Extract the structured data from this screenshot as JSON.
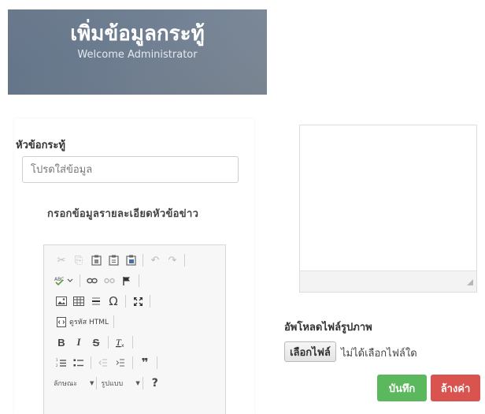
{
  "header": {
    "title": "เพิ่มข้อมูลกระทู้",
    "subtitle": "Welcome Administrator"
  },
  "form": {
    "subject_label": "หัวข้อกระทู้",
    "subject_placeholder": "โปรดใส่ข้อมูล",
    "detail_label": "กรอกข้อมูลรายละเอียดหัวข้อข่าว"
  },
  "editor": {
    "source_label": "ดูรหัส HTML",
    "format_combo": "ลักษณะ",
    "style_combo": "รูปแบบ",
    "help_label": "?",
    "icons": [
      "cut-icon",
      "copy-icon",
      "paste-icon",
      "paste-text-icon",
      "paste-word-icon",
      "undo-icon",
      "redo-icon",
      "spellcheck-icon",
      "link-icon",
      "unlink-icon",
      "anchor-icon",
      "image-icon",
      "table-icon",
      "horizontal-rule-icon",
      "special-char-icon",
      "maximize-icon",
      "source-icon",
      "bold-icon",
      "italic-icon",
      "strike-icon",
      "remove-format-icon",
      "numbered-list-icon",
      "bulleted-list-icon",
      "outdent-icon",
      "indent-icon",
      "blockquote-icon"
    ]
  },
  "upload": {
    "label": "อัพโหลดไฟล์รูปภาพ",
    "button": "เลือกไฟล์",
    "status": "ไม่ได้เลือกไฟล์ใด"
  },
  "actions": {
    "save": "บันทึก",
    "reset": "ล้างค่า"
  },
  "colors": {
    "save": "#5cb85c",
    "reset": "#d9534f",
    "banner": "#6f7f92"
  }
}
